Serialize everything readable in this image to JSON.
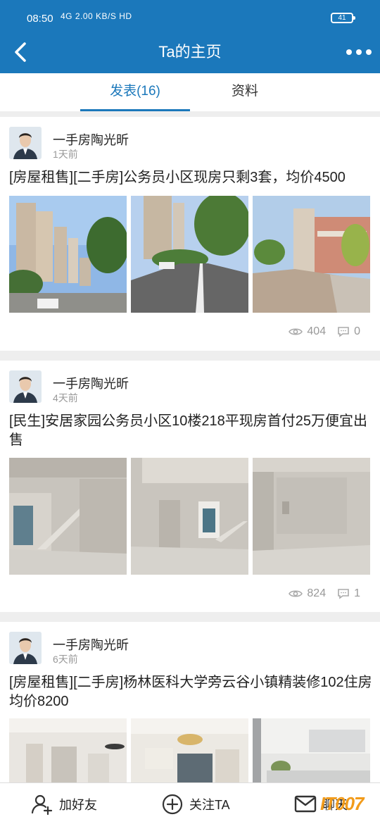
{
  "status_bar": {
    "time": "08:50",
    "network": "4G 2.00 KB/S HD",
    "battery": "41"
  },
  "header": {
    "title": "Ta的主页"
  },
  "tabs": [
    {
      "label": "发表(16)"
    },
    {
      "label": "资料"
    }
  ],
  "posts": [
    {
      "author": "一手房陶光昕",
      "time": "1天前",
      "title": "[房屋租售][二手房]公务员小区现房只剩3套，均价4500",
      "views": "404",
      "comments": "0"
    },
    {
      "author": "一手房陶光昕",
      "time": "4天前",
      "title": "[民生]安居家园公务员小区10楼218平现房首付25万便宜出售",
      "views": "824",
      "comments": "1"
    },
    {
      "author": "一手房陶光昕",
      "time": "6天前",
      "title": "[房屋租售][二手房]杨林医科大学旁云谷小镇精装修102住房均价8200",
      "views": "",
      "comments": ""
    }
  ],
  "bottom_bar": {
    "add_friend": "加好友",
    "follow": "关注TA",
    "chat": "聊天"
  },
  "watermark": "IT007",
  "colors": {
    "primary": "#1b78bb",
    "accent": "#f29b1a"
  }
}
